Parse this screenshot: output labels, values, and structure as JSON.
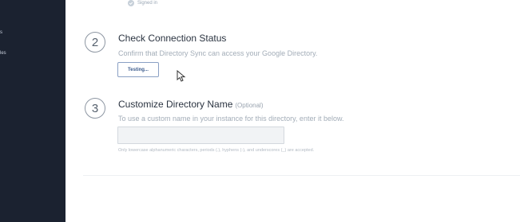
{
  "sidebar": {
    "items": [
      {
        "label": "s"
      },
      {
        "label": "les"
      }
    ]
  },
  "previous_step": {
    "status_label": "Signed in"
  },
  "step2": {
    "number": "2",
    "title": "Check Connection Status",
    "description": "Confirm that Directory Sync can access your Google Directory.",
    "button_label": "Testing..."
  },
  "step3": {
    "number": "3",
    "title": "Customize Directory Name",
    "optional_label": "(Optional)",
    "description": "To use a custom name in your instance for this directory, enter it below.",
    "input_value": "",
    "help_text": "Only lowercase alphanumeric characters, periods (.), hyphens (-), and underscores (_) are accepted."
  },
  "colors": {
    "sidebar_bg": "#1b2230",
    "button_border": "#8aa0c4",
    "button_text": "#3a5a8c"
  },
  "icons": {
    "signed_in": "check-circle-icon",
    "cursor": "mouse-pointer-icon"
  }
}
